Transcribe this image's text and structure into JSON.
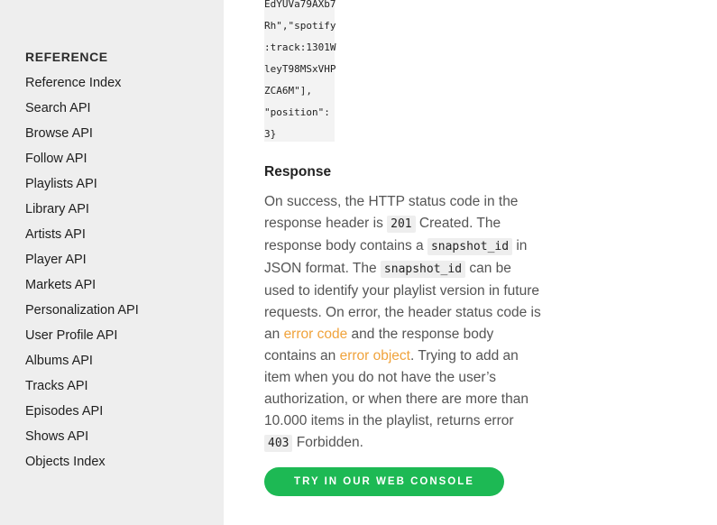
{
  "sidebar": {
    "heading": "REFERENCE",
    "items": [
      {
        "label": "Reference Index"
      },
      {
        "label": "Search API"
      },
      {
        "label": "Browse API"
      },
      {
        "label": "Follow API"
      },
      {
        "label": "Playlists API"
      },
      {
        "label": "Library API"
      },
      {
        "label": "Artists API"
      },
      {
        "label": "Player API"
      },
      {
        "label": "Markets API"
      },
      {
        "label": "Personalization API"
      },
      {
        "label": "User Profile API"
      },
      {
        "label": "Albums API"
      },
      {
        "label": "Tracks API"
      },
      {
        "label": "Episodes API"
      },
      {
        "label": "Shows API"
      },
      {
        "label": "Objects Index"
      }
    ]
  },
  "code_lines": [
    "EdYUVa79AXb7",
    "Rh\",\"spotify",
    ":track:1301W",
    "leyT98MSxVHP",
    "ZCA6M\"],",
    "\"position\":",
    "3}"
  ],
  "response": {
    "title": "Response",
    "p1": "On success, the HTTP status code in the response header is ",
    "code_201": "201",
    "p2": " Created. The response body contains a ",
    "code_snapshot1": "snapshot_id",
    "p3": " in JSON format. The ",
    "code_snapshot2": "snapshot_id",
    "p4": " can be used to identify your playlist version in future requests. On error, the header status code is an ",
    "link_error_code": "error code",
    "p5": " and the response body contains an ",
    "link_error_object": "error object",
    "p6": ". Trying to add an item when you do not have the user’s authorization, or when there are more than 10.000 items in the playlist, returns error ",
    "code_403": "403",
    "p7": " Forbidden."
  },
  "cta": {
    "label": "TRY IN OUR WEB CONSOLE"
  },
  "colors": {
    "accent_green": "#1db954",
    "link_orange": "#f0a33c",
    "sidebar_bg": "#eeeeee"
  }
}
